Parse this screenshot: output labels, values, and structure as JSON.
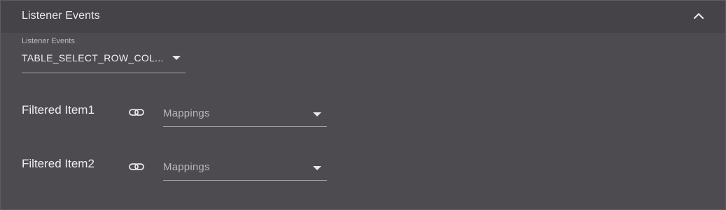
{
  "panel": {
    "title": "Listener Events",
    "collapse_icon": "chevron-up-icon"
  },
  "listener_select": {
    "label": "Listener Events",
    "value": "TABLE_SELECT_ROW_COL...",
    "icon": "caret-down-icon"
  },
  "items": [
    {
      "label": "Filtered Item1",
      "link_icon": "link-icon",
      "mapping_placeholder": "Mappings"
    },
    {
      "label": "Filtered Item2",
      "link_icon": "link-icon",
      "mapping_placeholder": "Mappings"
    }
  ],
  "colors": {
    "background": "#4e4b50",
    "header": "#454248",
    "text": "#eeedef",
    "muted_text": "#b9b7bb",
    "underline": "#a7a5a9"
  }
}
